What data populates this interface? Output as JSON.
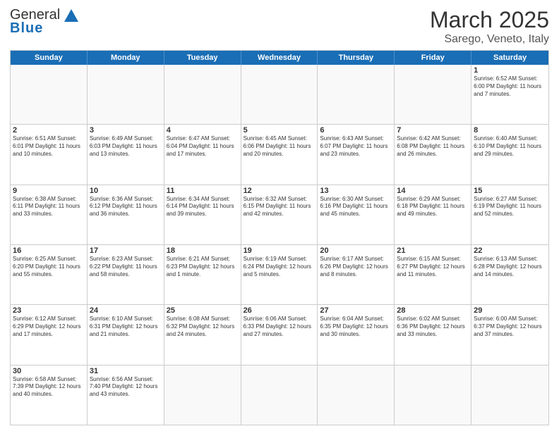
{
  "header": {
    "logo_general": "General",
    "logo_blue": "Blue",
    "title": "March 2025",
    "subtitle": "Sarego, Veneto, Italy"
  },
  "days_of_week": [
    "Sunday",
    "Monday",
    "Tuesday",
    "Wednesday",
    "Thursday",
    "Friday",
    "Saturday"
  ],
  "weeks": [
    [
      {
        "day": "",
        "info": ""
      },
      {
        "day": "",
        "info": ""
      },
      {
        "day": "",
        "info": ""
      },
      {
        "day": "",
        "info": ""
      },
      {
        "day": "",
        "info": ""
      },
      {
        "day": "",
        "info": ""
      },
      {
        "day": "1",
        "info": "Sunrise: 6:52 AM\nSunset: 6:00 PM\nDaylight: 11 hours\nand 7 minutes."
      }
    ],
    [
      {
        "day": "2",
        "info": "Sunrise: 6:51 AM\nSunset: 6:01 PM\nDaylight: 11 hours\nand 10 minutes."
      },
      {
        "day": "3",
        "info": "Sunrise: 6:49 AM\nSunset: 6:03 PM\nDaylight: 11 hours\nand 13 minutes."
      },
      {
        "day": "4",
        "info": "Sunrise: 6:47 AM\nSunset: 6:04 PM\nDaylight: 11 hours\nand 17 minutes."
      },
      {
        "day": "5",
        "info": "Sunrise: 6:45 AM\nSunset: 6:06 PM\nDaylight: 11 hours\nand 20 minutes."
      },
      {
        "day": "6",
        "info": "Sunrise: 6:43 AM\nSunset: 6:07 PM\nDaylight: 11 hours\nand 23 minutes."
      },
      {
        "day": "7",
        "info": "Sunrise: 6:42 AM\nSunset: 6:08 PM\nDaylight: 11 hours\nand 26 minutes."
      },
      {
        "day": "8",
        "info": "Sunrise: 6:40 AM\nSunset: 6:10 PM\nDaylight: 11 hours\nand 29 minutes."
      }
    ],
    [
      {
        "day": "9",
        "info": "Sunrise: 6:38 AM\nSunset: 6:11 PM\nDaylight: 11 hours\nand 33 minutes."
      },
      {
        "day": "10",
        "info": "Sunrise: 6:36 AM\nSunset: 6:12 PM\nDaylight: 11 hours\nand 36 minutes."
      },
      {
        "day": "11",
        "info": "Sunrise: 6:34 AM\nSunset: 6:14 PM\nDaylight: 11 hours\nand 39 minutes."
      },
      {
        "day": "12",
        "info": "Sunrise: 6:32 AM\nSunset: 6:15 PM\nDaylight: 11 hours\nand 42 minutes."
      },
      {
        "day": "13",
        "info": "Sunrise: 6:30 AM\nSunset: 6:16 PM\nDaylight: 11 hours\nand 45 minutes."
      },
      {
        "day": "14",
        "info": "Sunrise: 6:29 AM\nSunset: 6:18 PM\nDaylight: 11 hours\nand 49 minutes."
      },
      {
        "day": "15",
        "info": "Sunrise: 6:27 AM\nSunset: 6:19 PM\nDaylight: 11 hours\nand 52 minutes."
      }
    ],
    [
      {
        "day": "16",
        "info": "Sunrise: 6:25 AM\nSunset: 6:20 PM\nDaylight: 11 hours\nand 55 minutes."
      },
      {
        "day": "17",
        "info": "Sunrise: 6:23 AM\nSunset: 6:22 PM\nDaylight: 11 hours\nand 58 minutes."
      },
      {
        "day": "18",
        "info": "Sunrise: 6:21 AM\nSunset: 6:23 PM\nDaylight: 12 hours\nand 1 minute."
      },
      {
        "day": "19",
        "info": "Sunrise: 6:19 AM\nSunset: 6:24 PM\nDaylight: 12 hours\nand 5 minutes."
      },
      {
        "day": "20",
        "info": "Sunrise: 6:17 AM\nSunset: 6:26 PM\nDaylight: 12 hours\nand 8 minutes."
      },
      {
        "day": "21",
        "info": "Sunrise: 6:15 AM\nSunset: 6:27 PM\nDaylight: 12 hours\nand 11 minutes."
      },
      {
        "day": "22",
        "info": "Sunrise: 6:13 AM\nSunset: 6:28 PM\nDaylight: 12 hours\nand 14 minutes."
      }
    ],
    [
      {
        "day": "23",
        "info": "Sunrise: 6:12 AM\nSunset: 6:29 PM\nDaylight: 12 hours\nand 17 minutes."
      },
      {
        "day": "24",
        "info": "Sunrise: 6:10 AM\nSunset: 6:31 PM\nDaylight: 12 hours\nand 21 minutes."
      },
      {
        "day": "25",
        "info": "Sunrise: 6:08 AM\nSunset: 6:32 PM\nDaylight: 12 hours\nand 24 minutes."
      },
      {
        "day": "26",
        "info": "Sunrise: 6:06 AM\nSunset: 6:33 PM\nDaylight: 12 hours\nand 27 minutes."
      },
      {
        "day": "27",
        "info": "Sunrise: 6:04 AM\nSunset: 6:35 PM\nDaylight: 12 hours\nand 30 minutes."
      },
      {
        "day": "28",
        "info": "Sunrise: 6:02 AM\nSunset: 6:36 PM\nDaylight: 12 hours\nand 33 minutes."
      },
      {
        "day": "29",
        "info": "Sunrise: 6:00 AM\nSunset: 6:37 PM\nDaylight: 12 hours\nand 37 minutes."
      }
    ],
    [
      {
        "day": "30",
        "info": "Sunrise: 6:58 AM\nSunset: 7:39 PM\nDaylight: 12 hours\nand 40 minutes."
      },
      {
        "day": "31",
        "info": "Sunrise: 6:56 AM\nSunset: 7:40 PM\nDaylight: 12 hours\nand 43 minutes."
      },
      {
        "day": "",
        "info": ""
      },
      {
        "day": "",
        "info": ""
      },
      {
        "day": "",
        "info": ""
      },
      {
        "day": "",
        "info": ""
      },
      {
        "day": "",
        "info": ""
      }
    ]
  ]
}
